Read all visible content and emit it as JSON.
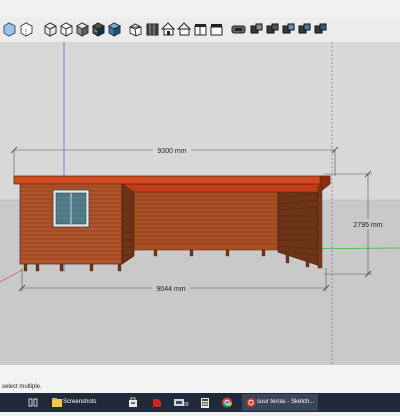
{
  "toolbar": {
    "icons": [
      "xray-icon",
      "back-edges-icon",
      "wireframe-icon",
      "hidden-line-icon",
      "shaded-icon",
      "shaded-textures-icon",
      "monochrome-icon",
      "iso-view-icon",
      "top-view-icon",
      "front-view-icon",
      "right-view-icon",
      "back-view-icon",
      "left-view-icon",
      "bottom-view-icon",
      "section-plane-icon",
      "display-section-icon",
      "section-cuts-icon",
      "section-fill-icon",
      "section-planes-visible-icon",
      "scene-icon"
    ]
  },
  "model": {
    "dimension_length": "9300 mm",
    "dimension_height": "2795 mm",
    "dimension_base": "9044 mm"
  },
  "status": {
    "text": "select multiple."
  },
  "taskbar": {
    "apps": [
      {
        "name": "task-view",
        "label": ""
      },
      {
        "name": "screenshots-folder",
        "label": "Screenshots"
      },
      {
        "name": "store",
        "label": ""
      },
      {
        "name": "app-red",
        "label": ""
      },
      {
        "name": "app-20",
        "label": "20"
      },
      {
        "name": "calculator",
        "label": ""
      },
      {
        "name": "chrome",
        "label": ""
      },
      {
        "name": "sketchup",
        "label": "suur terras - Sketch..."
      }
    ]
  },
  "colors": {
    "sky": "#d6d6d6",
    "ground": "#c8c8c8",
    "wood": "#b0552b",
    "wood_dark": "#6e3418",
    "roof": "#d24a20",
    "axis_blue": "#4a5ad8",
    "axis_green": "#2db82d",
    "axis_red": "#d63b3b"
  }
}
